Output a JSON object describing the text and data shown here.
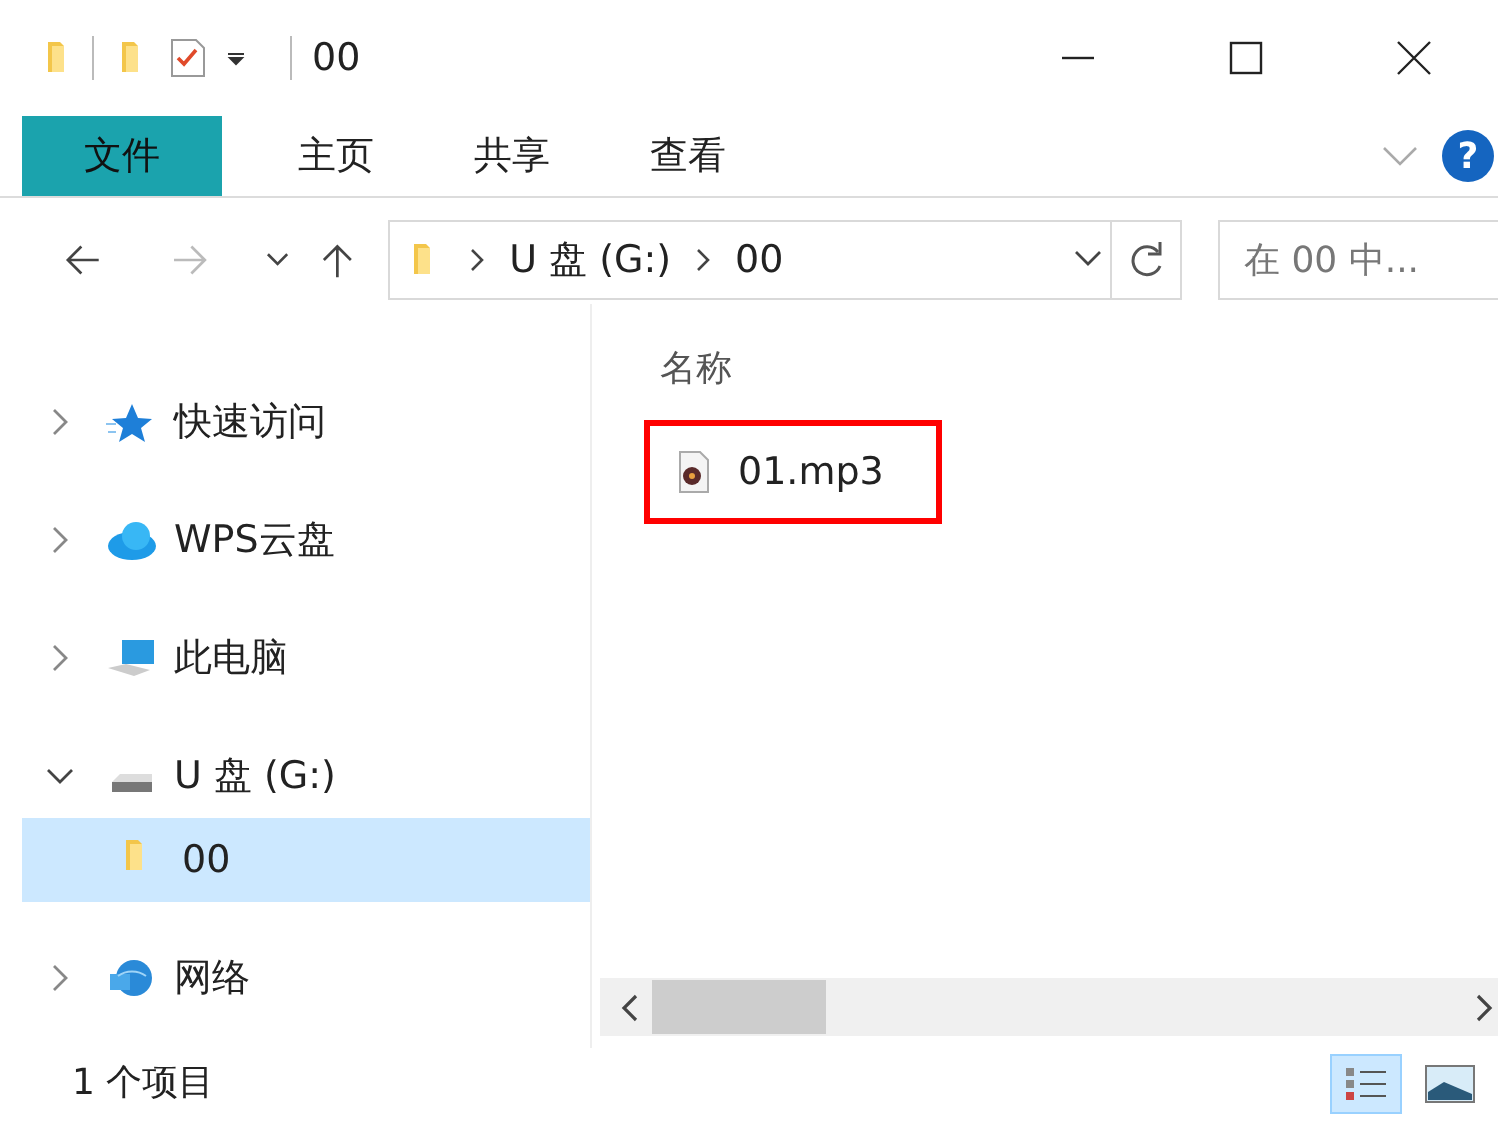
{
  "window": {
    "title": "00"
  },
  "ribbon": {
    "tabs": [
      {
        "label": "文件",
        "selected": true
      },
      {
        "label": "主页",
        "selected": false
      },
      {
        "label": "共享",
        "selected": false
      },
      {
        "label": "查看",
        "selected": false
      }
    ],
    "help_label": "?"
  },
  "address": {
    "path": [
      "U 盘 (G:)",
      "00"
    ]
  },
  "search": {
    "placeholder": "在 00 中..."
  },
  "nav_tree": [
    {
      "label": "快速访问",
      "kind": "star",
      "expanded": false,
      "selected": false
    },
    {
      "label": "WPS云盘",
      "kind": "cloud",
      "expanded": false,
      "selected": false
    },
    {
      "label": "此电脑",
      "kind": "computer",
      "expanded": false,
      "selected": false
    },
    {
      "label": "U 盘 (G:)",
      "kind": "drive",
      "expanded": true,
      "selected": false,
      "children": [
        {
          "label": "00",
          "kind": "folder",
          "selected": true
        }
      ]
    },
    {
      "label": "网络",
      "kind": "network",
      "expanded": false,
      "selected": false
    }
  ],
  "file_list": {
    "columns": [
      "名称"
    ],
    "files": [
      {
        "name": "01.mp3",
        "highlighted": true
      }
    ]
  },
  "status_bar": {
    "item_count": "1 个项目"
  },
  "view_buttons": [
    {
      "kind": "details",
      "selected": true
    },
    {
      "kind": "thumbnails",
      "selected": false
    }
  ]
}
